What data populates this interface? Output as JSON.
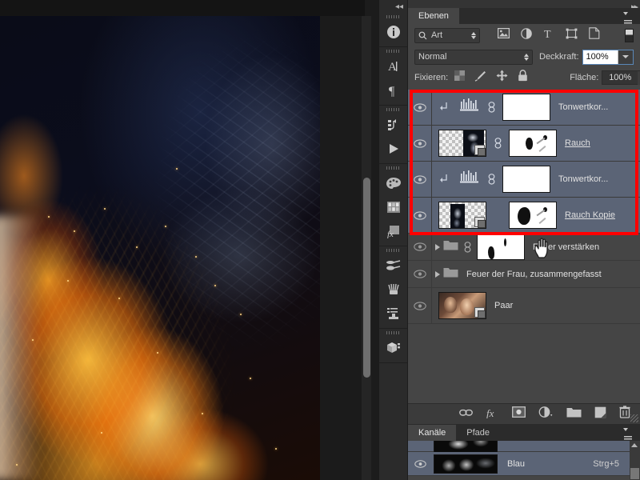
{
  "dock": {
    "collapse_icon": "double-chevron-left-icon",
    "groups": [
      {
        "items": [
          {
            "icon": "info-icon",
            "name": "info-panel-button"
          }
        ]
      },
      {
        "items": [
          {
            "icon": "character-panel-icon",
            "name": "character-panel-button"
          },
          {
            "icon": "paragraph-panel-icon",
            "name": "paragraph-panel-button"
          }
        ]
      },
      {
        "items": [
          {
            "icon": "history-icon",
            "name": "history-panel-button"
          },
          {
            "icon": "play-icon",
            "name": "actions-panel-button"
          }
        ]
      },
      {
        "items": [
          {
            "icon": "color-palette-icon",
            "name": "color-panel-button"
          },
          {
            "icon": "swatches-grid-icon",
            "name": "swatches-panel-button"
          },
          {
            "icon": "styles-fx-icon",
            "name": "styles-panel-button"
          }
        ]
      },
      {
        "items": [
          {
            "icon": "brush-presets-icon",
            "name": "brush-presets-button"
          },
          {
            "icon": "brush-tip-icon",
            "name": "brush-panel-button"
          },
          {
            "icon": "tool-presets-icon",
            "name": "tool-presets-button"
          }
        ]
      },
      {
        "items": [
          {
            "icon": "3d-cube-icon",
            "name": "3d-panel-button"
          }
        ]
      }
    ]
  },
  "panels": {
    "collapse_icon": "double-chevron-right-icon",
    "layers": {
      "tab_label": "Ebenen",
      "menu_icon": "panel-menu-icon",
      "filter": {
        "kind_label": "Art",
        "search_icon": "search-icon",
        "icons": [
          {
            "icon": "pixel-layer-filter-icon",
            "name": "filter-pixel-layers"
          },
          {
            "icon": "adjustment-layer-filter-icon",
            "name": "filter-adjustment-layers"
          },
          {
            "icon": "type-layer-filter-icon",
            "name": "filter-type-layers"
          },
          {
            "icon": "shape-layer-filter-icon",
            "name": "filter-shape-layers"
          },
          {
            "icon": "smart-object-filter-icon",
            "name": "filter-smart-objects"
          }
        ],
        "toggle_name": "filter-enable-toggle"
      },
      "blend_mode": "Normal",
      "opacity_label": "Deckkraft:",
      "opacity_value": "100%",
      "lock_label": "Fixieren:",
      "lock_icons": [
        {
          "icon": "lock-transparent-pixels-icon",
          "name": "lock-transparency-button"
        },
        {
          "icon": "lock-image-pixels-icon",
          "name": "lock-pixels-button"
        },
        {
          "icon": "lock-position-icon",
          "name": "lock-position-button"
        },
        {
          "icon": "lock-all-icon",
          "name": "lock-all-button"
        }
      ],
      "fill_label": "Fläche:",
      "fill_value": "100%",
      "rows": [
        {
          "name": "Tonwertkor...",
          "type": "adjustment",
          "kind": "levels",
          "selected": true,
          "clipped": true,
          "linked": true,
          "visible": true,
          "underline": false
        },
        {
          "name": "Rauch",
          "type": "pixel",
          "selected": true,
          "clipped": false,
          "linked": true,
          "visible": true,
          "underline": true
        },
        {
          "name": "Tonwertkor...",
          "type": "adjustment",
          "kind": "levels",
          "selected": true,
          "clipped": true,
          "linked": true,
          "visible": true,
          "underline": false
        },
        {
          "name": "Rauch Kopie",
          "type": "pixel",
          "selected": true,
          "clipped": false,
          "linked": false,
          "visible": true,
          "underline": true
        },
        {
          "name": "Feuer verstärken",
          "type": "group",
          "selected": false,
          "clipped": false,
          "linked": true,
          "visible": true,
          "underline": false,
          "has_mask": true
        },
        {
          "name": "Feuer der Frau, zusammengefasst",
          "type": "group",
          "selected": false,
          "clipped": false,
          "linked": false,
          "visible": true,
          "underline": false,
          "has_mask": false
        },
        {
          "name": "Paar",
          "type": "pixel-photo",
          "selected": false,
          "clipped": false,
          "linked": false,
          "visible": true,
          "underline": false
        }
      ],
      "bottom_buttons": [
        {
          "icon": "link-layers-icon",
          "name": "link-layers-button"
        },
        {
          "icon": "layer-style-fx-icon",
          "name": "add-layer-style-button"
        },
        {
          "icon": "add-layer-mask-icon",
          "name": "add-layer-mask-button"
        },
        {
          "icon": "new-adjustment-layer-icon",
          "name": "new-adjustment-layer-button"
        },
        {
          "icon": "new-group-icon",
          "name": "new-group-button"
        },
        {
          "icon": "new-layer-icon",
          "name": "new-layer-button"
        },
        {
          "icon": "trash-icon",
          "name": "delete-layer-button"
        }
      ]
    },
    "channels": {
      "tabs": [
        {
          "label": "Kanäle",
          "active": true,
          "name": "tab-kanaele"
        },
        {
          "label": "Pfade",
          "active": false,
          "name": "tab-pfade"
        }
      ],
      "menu_icon": "panel-menu-icon",
      "rows": [
        {
          "label": "",
          "shortcut": "",
          "name": "channel-row-green-partial"
        },
        {
          "label": "Blau",
          "shortcut": "Strg+5",
          "name": "channel-row-blue"
        }
      ]
    }
  },
  "selection_highlight": {
    "color": "#ff0000",
    "name": "red-annotation-rectangle"
  },
  "cursor": {
    "type": "hand-cursor"
  },
  "canvas": {
    "title": "",
    "scrollbar_name": "canvas-vertical-scrollbar"
  }
}
